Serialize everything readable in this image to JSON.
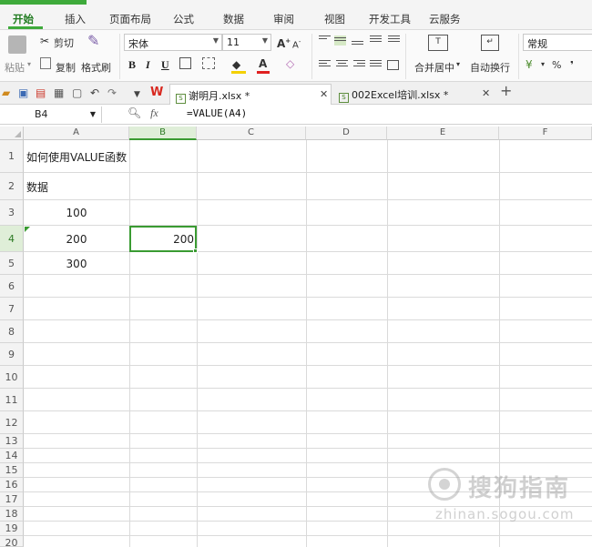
{
  "menu": {
    "tabs": [
      "开始",
      "插入",
      "页面布局",
      "公式",
      "数据",
      "审阅",
      "视图",
      "开发工具",
      "云服务"
    ],
    "active_tab": "开始"
  },
  "ribbon": {
    "paste_label": "粘贴",
    "cut_label": "剪切",
    "copy_label": "复制",
    "format_painter_label": "格式刷",
    "font_name": "宋体",
    "font_size": "11",
    "bold": "B",
    "italic": "I",
    "underline": "U",
    "merge_label": "合并居中",
    "wrap_label": "自动换行",
    "number_format": "常规",
    "percent": "%",
    "comma": "❜"
  },
  "doc_tabs": [
    {
      "label": "谢明月.xlsx *",
      "active": true
    },
    {
      "label": "002Excel培训.xlsx *",
      "active": false
    }
  ],
  "formula_bar": {
    "name_box": "B4",
    "fx": "fx",
    "formula": "=VALUE(A4)"
  },
  "sheet": {
    "columns": [
      "A",
      "B",
      "C",
      "D",
      "E",
      "F"
    ],
    "selected_column": "B",
    "rows": [
      "1",
      "2",
      "3",
      "4",
      "5",
      "6",
      "7",
      "8",
      "9",
      "10",
      "11",
      "12",
      "13",
      "14",
      "15",
      "16",
      "17",
      "18",
      "19",
      "20"
    ],
    "selected_row": "4",
    "cells": {
      "A1": "如何使用VALUE函数",
      "A2": "数据",
      "A3": "100",
      "A4": "200",
      "A5": "300",
      "B4": "200"
    }
  },
  "watermark": {
    "cn": "搜狗指南",
    "en": "zhinan.sogou.com"
  },
  "colors": {
    "accent": "#3a9b32",
    "tab_strip": "#3eaa3b"
  }
}
